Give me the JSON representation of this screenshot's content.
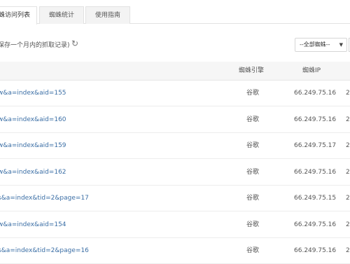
{
  "tabs": [
    {
      "label": "蛛访问列表",
      "active": true
    },
    {
      "label": "蜘蛛统计",
      "active": false
    },
    {
      "label": "使用指南",
      "active": false
    }
  ],
  "toolbar": {
    "note": "保存一个月内的抓取记录)",
    "refresh_icon": "refresh-icon",
    "filter_value": "--全部蜘蛛--",
    "caret": "▼"
  },
  "table": {
    "headers": {
      "engine": "蜘蛛引擎",
      "ip": "蜘蛛IP"
    },
    "rows": [
      {
        "url": "w&a=index&aid=155",
        "engine": "谷歌",
        "ip": "66.249.75.16",
        "extra": "2"
      },
      {
        "url": "w&a=index&aid=160",
        "engine": "谷歌",
        "ip": "66.249.75.16",
        "extra": "2"
      },
      {
        "url": "w&a=index&aid=159",
        "engine": "谷歌",
        "ip": "66.249.75.17",
        "extra": "2"
      },
      {
        "url": "w&a=index&aid=162",
        "engine": "谷歌",
        "ip": "66.249.75.16",
        "extra": "2"
      },
      {
        "url": "s&a=index&tid=2&page=17",
        "engine": "谷歌",
        "ip": "66.249.75.15",
        "extra": "2"
      },
      {
        "url": "w&a=index&aid=154",
        "engine": "谷歌",
        "ip": "66.249.75.16",
        "extra": "2"
      },
      {
        "url": "s&a=index&tid=2&page=16",
        "engine": "谷歌",
        "ip": "66.249.75.16",
        "extra": "2"
      }
    ]
  },
  "colors": {
    "link": "#3a6ea5",
    "header_bg": "#f6f6f6"
  }
}
